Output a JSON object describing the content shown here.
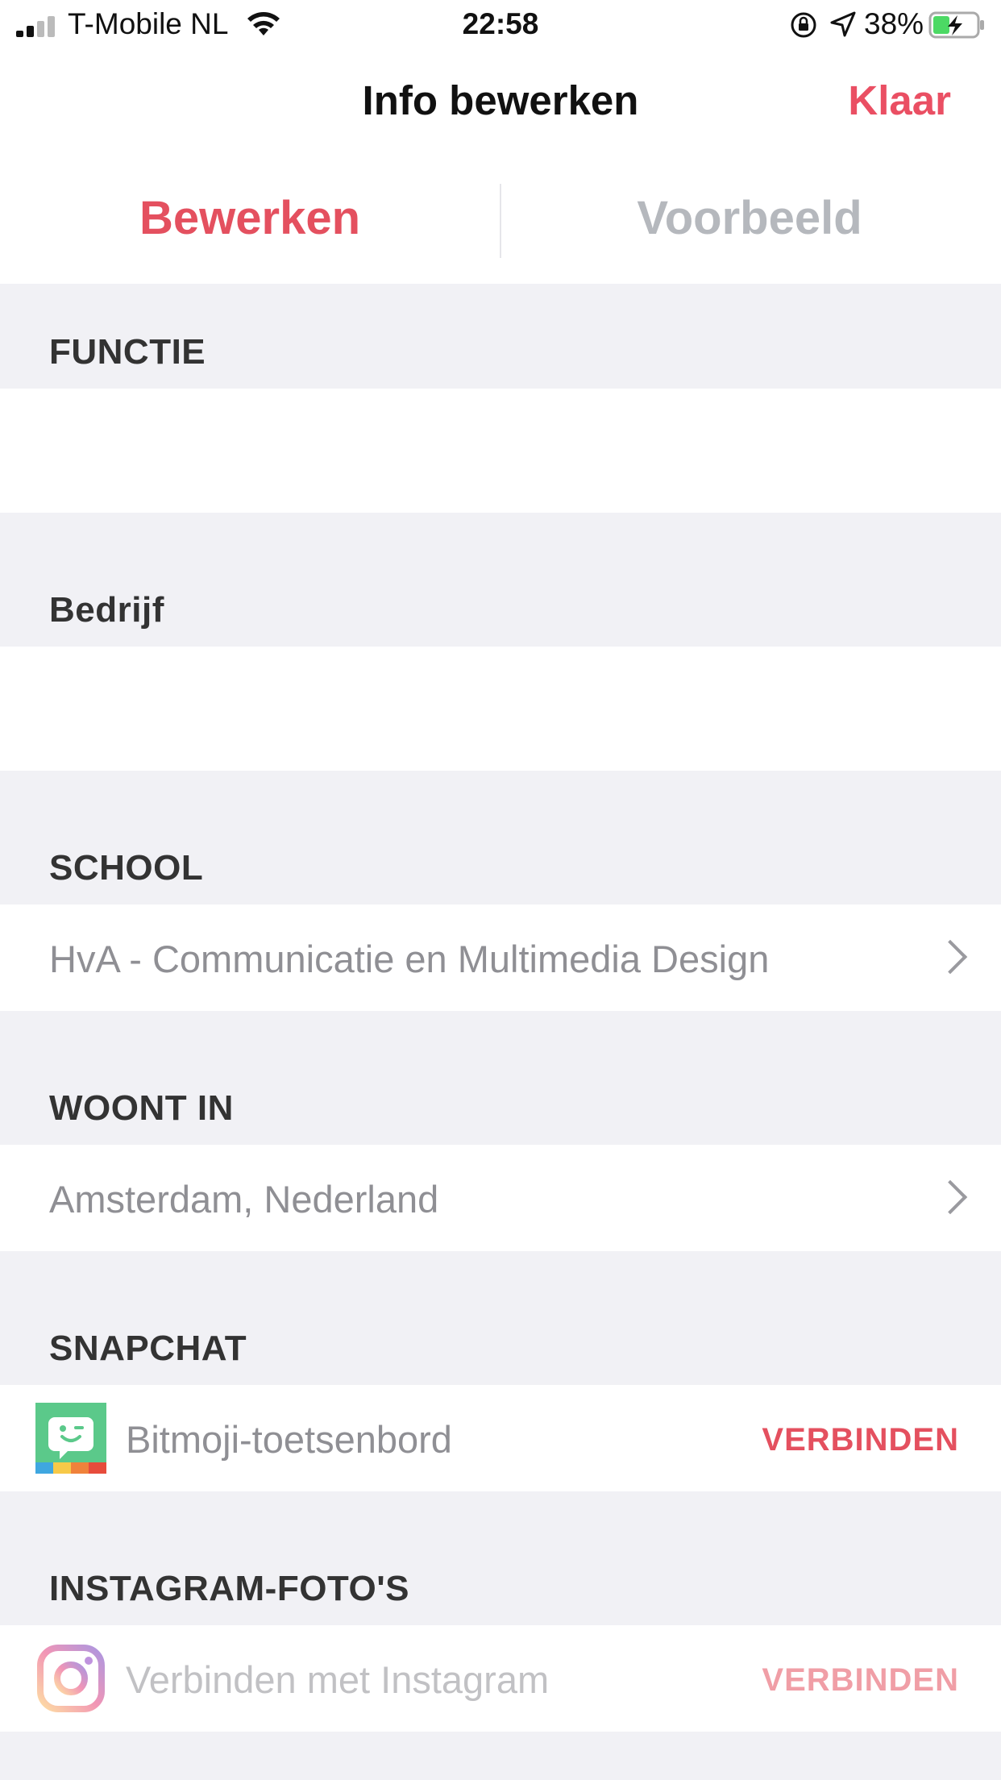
{
  "status": {
    "carrier": "T-Mobile NL",
    "time": "22:58",
    "battery": "38%",
    "battery_level": 0.38,
    "icons": [
      "signal-icon",
      "wifi-icon",
      "orientation-lock-icon",
      "location-icon",
      "battery-icon"
    ]
  },
  "header": {
    "title": "Info bewerken",
    "done_label": "Klaar"
  },
  "tabs": [
    {
      "label": "Bewerken",
      "active": true
    },
    {
      "label": "Voorbeeld",
      "active": false
    }
  ],
  "sections": {
    "functie": {
      "label": "FUNCTIE",
      "value": ""
    },
    "bedrijf": {
      "label": "Bedrijf",
      "value": ""
    },
    "school": {
      "label": "SCHOOL",
      "value": "HvA - Communicatie en Multimedia Design"
    },
    "woont_in": {
      "label": "WOONT IN",
      "value": "Amsterdam, Nederland"
    },
    "snapchat": {
      "label": "SNAPCHAT",
      "item": "Bitmoji-toetsenbord",
      "action": "VERBINDEN"
    },
    "instagram": {
      "label": "INSTAGRAM-FOTO'S",
      "item": "Verbinden met Instagram",
      "action": "VERBINDEN"
    }
  },
  "colors": {
    "accent": "#e4505f",
    "inactive_tab": "#b5b8bd",
    "background": "#f1f1f5"
  }
}
